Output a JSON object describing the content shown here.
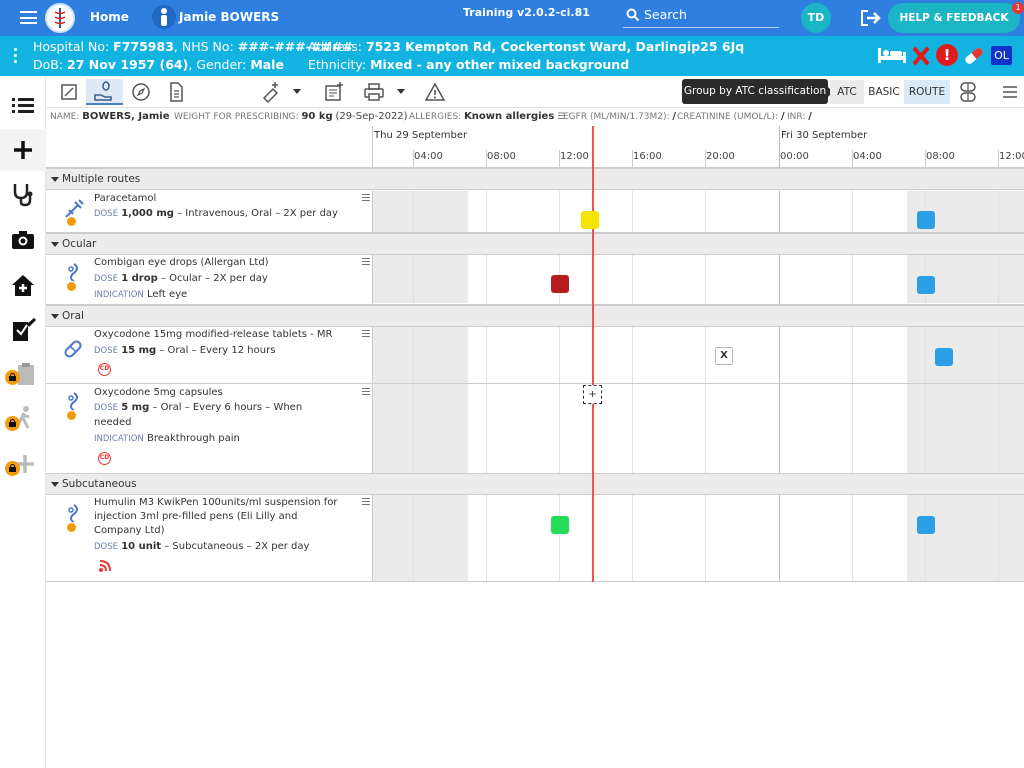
{
  "header": {
    "home_label": "Home",
    "patient_name": "Jamie BOWERS",
    "version": "Training v2.0.2-ci.81",
    "search_label": "Search",
    "user_initials": "TD",
    "help_label": "HELP & FEEDBACK",
    "help_badge": "1",
    "colors": {
      "bar": "#2f7fe0",
      "patient_bar": "#12b3e0"
    }
  },
  "patient": {
    "hospital_label": "Hospital No:",
    "hospital_no": "F775983",
    "nhs_label": ", NHS No:",
    "nhs_no": "###-###-####",
    "address_label": "Address:",
    "address": "7523 Kempton Rd, Cockertonst Ward, Darlingip25 6Jq",
    "dob_label": "DoB:",
    "dob": "27 Nov 1957 (64)",
    "gender_label": ", Gender:",
    "gender": "Male",
    "ethnicity_label": "Ethnicity:",
    "ethnicity": "Mixed - any other mixed background",
    "badge_ol": "OL"
  },
  "toolbar": {
    "tooltip": "Group by ATC classification",
    "atc_label": "ATC",
    "basic_label": "BASIC",
    "route_label": "ROUTE"
  },
  "infobar": {
    "name_label": "NAME:",
    "name": "BOWERS, Jamie",
    "weight_label": "WEIGHT FOR PRESCRIBING:",
    "weight": "90 kg",
    "weight_date": "(29-Sep-2022)",
    "allergies_label": "ALLERGIES:",
    "allergies": "Known allergies",
    "egfr_label": "EGFR (ML/MIN/1.73M2):",
    "egfr": "/",
    "creat_label": "CREATININE (UMOL/L):",
    "creat": "/",
    "inr_label": "INR:",
    "inr": "/"
  },
  "timeline": {
    "day1": "Thu 29 September",
    "day2": "Fri 30 September",
    "ticks": [
      "04:00",
      "08:00",
      "12:00",
      "16:00",
      "20:00",
      "00:00",
      "04:00",
      "08:00",
      "12:00"
    ]
  },
  "groups": [
    {
      "label": "Multiple routes"
    },
    {
      "label": "Ocular"
    },
    {
      "label": "Oral"
    },
    {
      "label": "Subcutaneous"
    }
  ],
  "meds": [
    {
      "name": "Paracetamol",
      "dose_label": "DOSE",
      "dose": "1,000 mg",
      "route": " – Intravenous, Oral – 2X per day"
    },
    {
      "name": "Combigan eye drops (Allergan Ltd)",
      "dose_label": "DOSE",
      "dose": "1 drop",
      "route": " – Ocular – 2X per day",
      "ind_label": "INDICATION",
      "indication": "Left eye"
    },
    {
      "name": "Oxycodone 15mg modified-release tablets - MR",
      "dose_label": "DOSE",
      "dose": "15 mg",
      "route": " – Oral – Every 12 hours",
      "cd": "CD"
    },
    {
      "name": "Oxycodone 5mg capsules",
      "dose_label": "DOSE",
      "dose": "5 mg",
      "route": " – Oral – Every 6 hours – When",
      "route2": "needed",
      "ind_label": "INDICATION",
      "indication": "Breakthrough pain",
      "cd": "CD"
    },
    {
      "name": "Humulin M3 KwikPen 100units/ml suspension for",
      "name2": "injection 3ml pre-filled pens (Eli Lilly and",
      "name3": "Company Ltd)",
      "dose_label": "DOSE",
      "dose": "10 unit",
      "route": " – Subcutaneous – 2X per day"
    }
  ],
  "dose_colors": {
    "due": "#f5e400",
    "missed": "#b71c1c",
    "given": "#22dd55",
    "scheduled": "#2d9fe6"
  },
  "marks": {
    "omitted": "X",
    "add": "+"
  }
}
